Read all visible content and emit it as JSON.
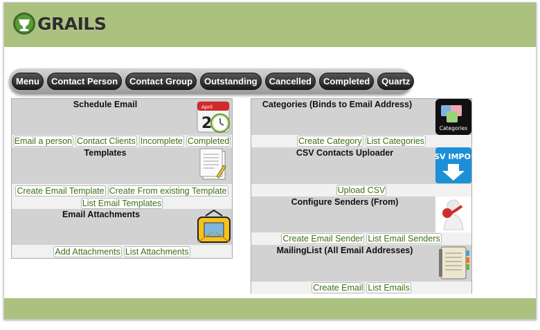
{
  "brand": {
    "name": "GRAILS",
    "colors": {
      "header": "#abc17f",
      "link": "#3e6f16",
      "nav": "#2a2a2a"
    }
  },
  "nav": {
    "items": [
      "Menu",
      "Contact Person",
      "Contact Group",
      "Outstanding",
      "Cancelled",
      "Completed",
      "Quartz"
    ]
  },
  "left_panel": {
    "sections": [
      {
        "title": "Schedule Email",
        "icon": "calendar-clock-icon",
        "links": [
          [
            "Email a person",
            "Contact Clients",
            "Incomplete",
            "Completed"
          ]
        ]
      },
      {
        "title": "Templates",
        "icon": "document-template-icon",
        "links": [
          [
            "Create Email Template",
            "Create From existing Template"
          ],
          [
            "List Email Templates"
          ]
        ]
      },
      {
        "title": "Email Attachments",
        "icon": "envelope-attachment-icon",
        "links": [
          [
            "Add Attachments",
            "List Attachments"
          ]
        ]
      }
    ]
  },
  "right_panel": {
    "sections": [
      {
        "title": "Categories (Binds to Email Address)",
        "icon": "categories-icon",
        "icon_label": "Categories",
        "links": [
          [
            "Create Category",
            "List Categories"
          ]
        ]
      },
      {
        "title": "CSV Contacts Uploader",
        "icon": "csv-import-icon",
        "icon_label": ".CSV IMPORT",
        "links": [
          [
            "Upload CSV"
          ]
        ]
      },
      {
        "title": "Configure Senders (From)",
        "icon": "sender-person-icon",
        "links": [
          [
            "Create Email Sender",
            "List Email Senders"
          ]
        ]
      },
      {
        "title": "MailingList (All Email Addresses)",
        "icon": "address-book-icon",
        "links": [
          [
            "Create Email",
            "List Emails"
          ]
        ]
      }
    ]
  }
}
